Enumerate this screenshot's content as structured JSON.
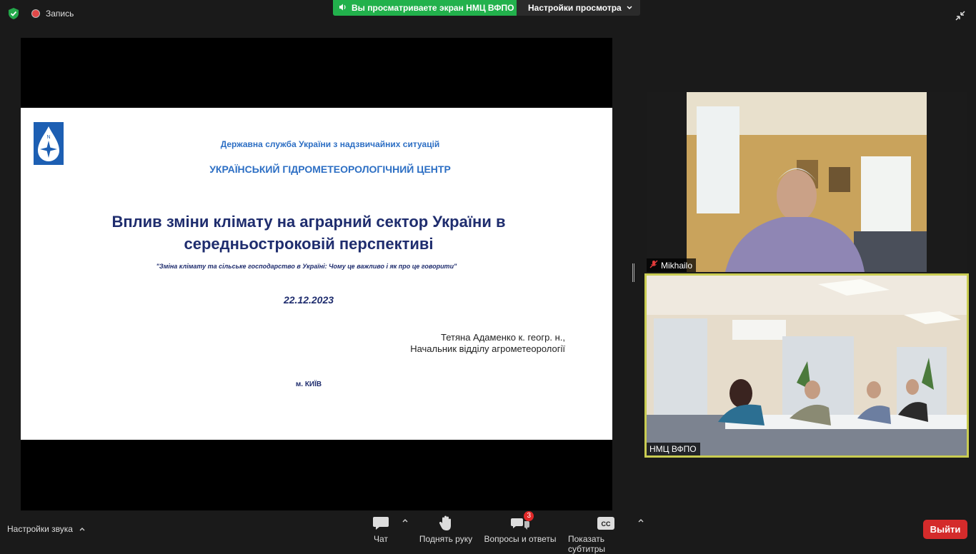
{
  "top": {
    "recording_label": "Запись",
    "sharing_banner": "Вы просматриваете экран НМЦ ВФПО",
    "view_options_label": "Настройки просмотра"
  },
  "slide": {
    "agency_line1": "Державна служба України з надзвичайних ситуацій",
    "agency_line2": "УКРАЇНСЬКИЙ ГІДРОМЕТЕОРОЛОГІЧНИЙ ЦЕНТР",
    "title_line1": "Вплив зміни клімату на аграрний сектор України в",
    "title_line2": "середньостроковій перспективі",
    "subtitle": "\"Зміна клімату та сільське господарство в Україні: Чому це важливо і як про це говорити\"",
    "date": "22.12.2023",
    "author_line1": "Тетяна Адаменко  к. геогр. н.,",
    "author_line2": "Начальник відділу агрометеорології",
    "city": "м. КИЇВ",
    "logo_letter": "N"
  },
  "participants": [
    {
      "name": "Mikhailo",
      "muted": true
    },
    {
      "name": "НМЦ ВФПО",
      "muted": false
    }
  ],
  "toolbar": {
    "audio_settings": "Настройки звука",
    "chat": "Чат",
    "raise_hand": "Поднять руку",
    "qa": "Вопросы и ответы",
    "qa_badge": "3",
    "captions": "Показать субтитры",
    "captions_icon_text": "CC",
    "leave": "Выйти"
  },
  "colors": {
    "sharing_green": "#22b14c",
    "leave_red": "#d42b2b",
    "active_speaker_border": "#c9cc52",
    "slide_title_blue": "#1f2d6e",
    "agency_blue": "#2d6fc4"
  }
}
